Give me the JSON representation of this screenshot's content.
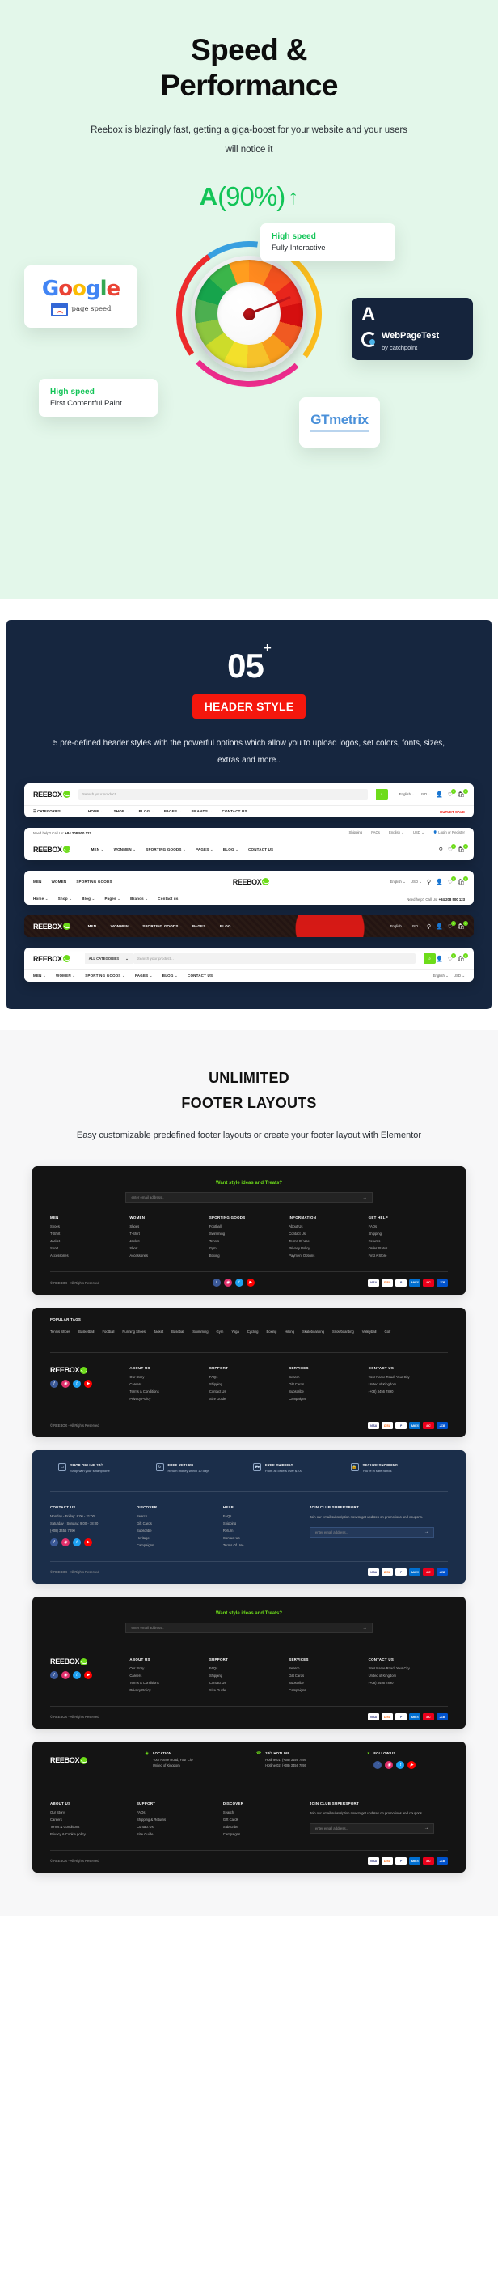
{
  "speed": {
    "title_line1": "Speed &",
    "title_line2": "Performance",
    "subtitle": "Reebox is blazingly fast, getting a giga-boost for your website and your users will notice it",
    "grade_letter": "A",
    "grade_percent": "(90%)",
    "grade_arrow": "↑",
    "cards": [
      {
        "title": "High speed",
        "sub": "Fully Interactive"
      },
      {
        "title": "High speed",
        "sub": "First Contentful Paint"
      }
    ],
    "google": {
      "word": [
        "G",
        "o",
        "o",
        "g",
        "l",
        "e"
      ],
      "label": "page speed"
    },
    "webpagetest": {
      "grade": "A",
      "name": "WebPageTest",
      "by": "by catchpoint"
    },
    "gtmetrix": {
      "name": "GTmetrix"
    }
  },
  "header_section": {
    "count": "05",
    "count_sup": "+",
    "badge": "HEADER STYLE",
    "description": "5 pre-defined header styles with the powerful options which allow you to upload logos, set colors, fonts, sizes, extras and more..",
    "brand": "REEBOX",
    "search_placeholder": "Search your product...",
    "all_categories": "ALL CATEGORIES",
    "categories_label": "CATEGORIES",
    "search_icon": "⌕",
    "lang": "English",
    "currency": "USD",
    "outlet_sale": "OUTLET SALE",
    "phone_label": "Need help? Call Us:",
    "phone": "+84 208 500 123",
    "login": "Login or Register",
    "toplinks": [
      "Shipping",
      "FAQs"
    ],
    "cart_count": "4",
    "wish_count": "4",
    "menu_main": [
      "HOME",
      "SHOP",
      "BLOG",
      "PAGES",
      "BRANDS",
      "CONTACT US"
    ],
    "menu_cat": [
      "MEN",
      "WONMEN",
      "SPORTING GOODS",
      "PAGES",
      "BLOG",
      "CONTACT US"
    ],
    "menu_left3": [
      "MEN",
      "WOMEN",
      "SPORTING GOODS"
    ],
    "menu_bottom3": [
      "Home",
      "Shop",
      "Blog",
      "Pages",
      "Brands",
      "Contact us"
    ],
    "menu_h5": [
      "MEN",
      "WOMEN",
      "SPORTING GOODS",
      "PAGES",
      "BLOG",
      "CONTACT US"
    ]
  },
  "footer_section": {
    "title_line1": "UNLIMITED",
    "title_line2": "FOOTER LAYOUTS",
    "description": "Easy customizable predefined footer layouts or create your footer layout with Elementor",
    "newsletter_title": "Want style ideas and Treats?",
    "email_placeholder": "enter email address..",
    "arrow": "→",
    "brand": "REEBOX",
    "copyright": "© REEBOX - All Rights Reserved",
    "payments": [
      "VISA",
      "DISC",
      "P",
      "AMEX",
      "MC",
      "JCB"
    ],
    "socials": [
      "f",
      "◉",
      "t",
      "▶"
    ],
    "columns_1": [
      {
        "head": "MEN",
        "items": [
          "Shoes",
          "T-Shirt",
          "Jacket",
          "Short",
          "Accessories"
        ]
      },
      {
        "head": "WOMEN",
        "items": [
          "Shoes",
          "T-Shirt",
          "Jacket",
          "Short",
          "Accessories"
        ]
      },
      {
        "head": "SPORTING GOODS",
        "items": [
          "Football",
          "Swimming",
          "Tennis",
          "Gym",
          "Boxing"
        ]
      },
      {
        "head": "INFORMATION",
        "items": [
          "About Us",
          "Contact Us",
          "Terms Of Use",
          "Privacy Policy",
          "Payment Options"
        ]
      },
      {
        "head": "GET HELP",
        "items": [
          "FAQs",
          "Shipping",
          "Returns",
          "Order Status",
          "Find A Store"
        ]
      }
    ],
    "popular_tags_head": "POPULAR TAGS",
    "popular_tags": [
      "Tennis Shoes",
      "Basketball",
      "Football",
      "Running Shoes",
      "Jacket",
      "Baseball",
      "Swimming",
      "Gym",
      "Yoga",
      "Cycling",
      "Boxing",
      "Hiking",
      "Skateboarding",
      "Snowboarding",
      "Volleyball",
      "Golf"
    ],
    "columns_2": [
      {
        "head": "ABOUT US",
        "items": [
          "Our Story",
          "Careers",
          "Terms & Conditions",
          "Privacy Policy"
        ]
      },
      {
        "head": "SUPPORT",
        "items": [
          "FAQs",
          "Shipping",
          "Contact Us",
          "Size Guide"
        ]
      },
      {
        "head": "SERVICES",
        "items": [
          "Search",
          "Gift Cards",
          "Subscribe",
          "Campaigns"
        ]
      },
      {
        "head": "CONTACT US",
        "items": [
          "Your Name Road, Your City",
          "United of Kingdom",
          "(+08) 3456 7890"
        ]
      }
    ],
    "features": [
      {
        "icon": "▭",
        "title": "SHOP ONLINE 24/7",
        "sub": "Shop with your smartphone"
      },
      {
        "icon": "↻",
        "title": "FREE RETURN",
        "sub": "Return money within 10 days"
      },
      {
        "icon": "⛟",
        "title": "FREE SHIPPING",
        "sub": "From all orders over $100"
      },
      {
        "icon": "🔒",
        "title": "SECURE SHOPPING",
        "sub": "You're in safe hands"
      }
    ],
    "columns_3": [
      {
        "head": "CONTACT US",
        "items": [
          "Monday - Friday: 8:00 - 21:00",
          "Saturday - Sunday: 9:00 - 18:00",
          "(+08) 3456 7890"
        ]
      },
      {
        "head": "DISCOVER",
        "items": [
          "Search",
          "Gift Cards",
          "Subscribe",
          "Heritage",
          "Campaigns"
        ]
      },
      {
        "head": "HELP",
        "items": [
          "FAQs",
          "Shipping",
          "Return",
          "Contact Us",
          "Terms Of Use"
        ]
      }
    ],
    "join_head": "JOIN CLUB SUPERSPORT",
    "join_desc": "Join our email subscription now to get updates on promotions and coupons.",
    "columns_4": [
      {
        "head": "ABOUT US",
        "items": [
          "Our Story",
          "Careers",
          "Terms & Conditions",
          "Privacy & Cookie policy"
        ]
      },
      {
        "head": "SUPPORT",
        "items": [
          "FAQs",
          "Shipping & Returns",
          "Contact Us",
          "Size Guide"
        ]
      },
      {
        "head": "DISCOVER",
        "items": [
          "Search",
          "Gift Cards",
          "Subscribe",
          "Campaigns"
        ]
      }
    ],
    "info_blocks": [
      {
        "icon": "◉",
        "title": "LOCATION",
        "sub": "Your Name Road, Your City\nUnited of Kingdom"
      },
      {
        "icon": "☎",
        "title": "24/7 HOTLINE",
        "sub": "Hotline 01: (+08) 3456 7890\nHotline 02: (+08) 3456 7890"
      },
      {
        "icon": "♥",
        "title": "FOLLOW US",
        "sub": ""
      }
    ]
  }
}
